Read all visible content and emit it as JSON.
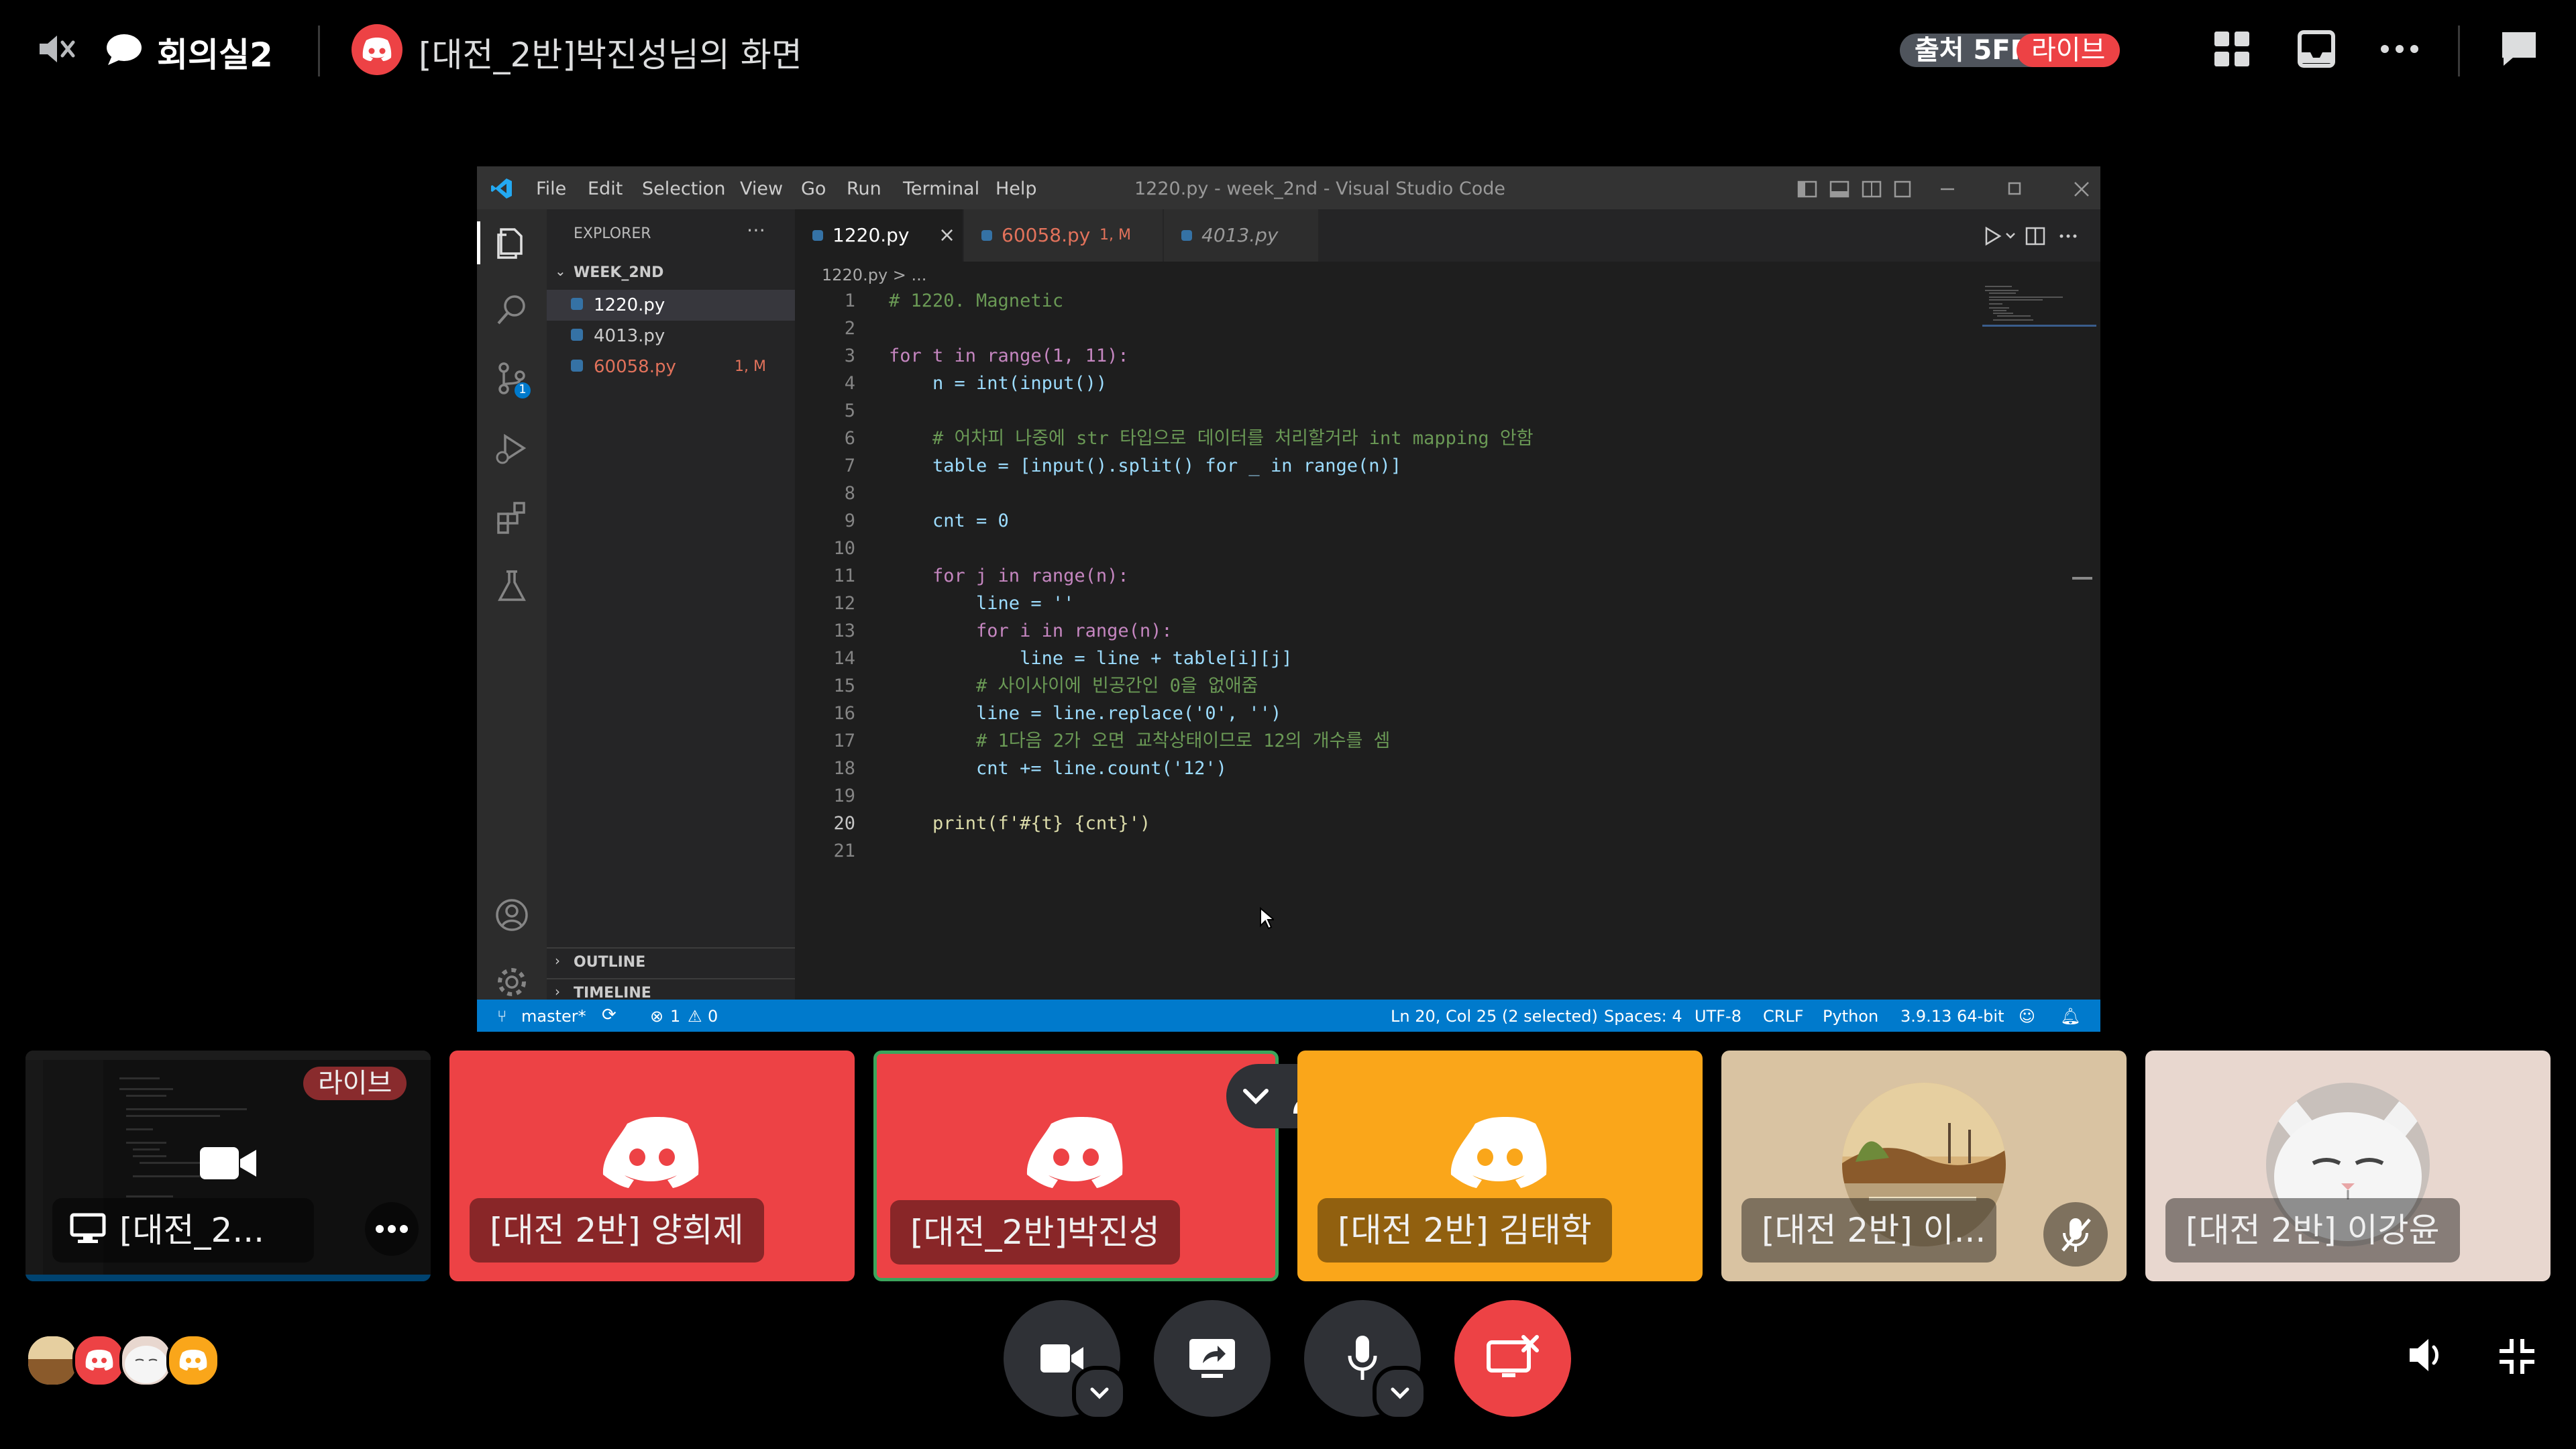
{
  "header": {
    "channel_name": "회의실2",
    "stream_title": "[대전_2반]박진성님의 화면",
    "quality_badge": "출처 5FPS",
    "live_badge": "라이브"
  },
  "vscode": {
    "window_title": "1220.py - week_2nd - Visual Studio Code",
    "menu": [
      "File",
      "Edit",
      "Selection",
      "View",
      "Go",
      "Run",
      "Terminal",
      "Help"
    ],
    "explorer_title": "EXPLORER",
    "folder": "WEEK_2ND",
    "files": [
      {
        "name": "1220.py",
        "badge": ""
      },
      {
        "name": "4013.py",
        "badge": ""
      },
      {
        "name": "60058.py",
        "badge": "1, M"
      }
    ],
    "outline_label": "OUTLINE",
    "timeline_label": "TIMELINE",
    "tabs": [
      {
        "name": "1220.py",
        "badge": ""
      },
      {
        "name": "60058.py",
        "badge": "1, M"
      },
      {
        "name": "4013.py",
        "badge": ""
      }
    ],
    "breadcrumb": "1220.py > ...",
    "source_control_count": "1",
    "line_numbers": [
      "1",
      "2",
      "3",
      "4",
      "5",
      "6",
      "7",
      "8",
      "9",
      "10",
      "11",
      "12",
      "13",
      "14",
      "15",
      "16",
      "17",
      "18",
      "19",
      "20",
      "21"
    ],
    "code_lines": [
      "# 1220. Magnetic",
      "",
      "for t in range(1, 11):",
      "    n = int(input())",
      "",
      "    # 어차피 나중에 str 타입으로 데이터를 처리할거라 int mapping 안함",
      "    table = [input().split() for _ in range(n)]",
      "",
      "    cnt = 0",
      "",
      "    for j in range(n):",
      "        line = ''",
      "        for i in range(n):",
      "            line = line + table[i][j]",
      "        # 사이사이에 빈공간인 0을 없애줌",
      "        line = line.replace('0', '')",
      "        # 1다음 2가 오면 교착상태이므로 12의 개수를 셈",
      "        cnt += line.count('12')",
      "",
      "    print(f'#{t} {cnt}')",
      ""
    ],
    "status": {
      "branch": "master*",
      "errors": "1",
      "warnings": "0",
      "position": "Ln 20, Col 25 (2 selected)",
      "spaces": "Spaces: 4",
      "encoding": "UTF-8",
      "eol": "CRLF",
      "language": "Python",
      "interpreter": "3.9.13 64-bit"
    }
  },
  "participants": [
    {
      "name": "[대전_2...",
      "type": "screen",
      "live": "라이브"
    },
    {
      "name": "[대전 2반] 양희제",
      "type": "discord",
      "color": "#ed4245"
    },
    {
      "name": "[대전_2반]박진성",
      "type": "discord",
      "color": "#ed4245"
    },
    {
      "name": "[대전 2반] 김태학",
      "type": "discord",
      "color": "#faa61a"
    },
    {
      "name": "[대전 2반] 이...",
      "type": "avatar-painting"
    },
    {
      "name": "[대전 2반] 이강윤",
      "type": "avatar-cat"
    }
  ],
  "colors": {
    "discord_red": "#ed4245",
    "discord_orange": "#faa61a",
    "live_red": "#ed4245",
    "speaking_green": "#3ba55c",
    "vscode_blue": "#007acc"
  },
  "icons": [
    "speaker-muted-icon",
    "chat-bubble-icon",
    "grid-icon",
    "inbox-icon",
    "more-icon",
    "chat-icon",
    "camera-icon",
    "screen-share-icon",
    "microphone-icon",
    "leave-icon",
    "volume-icon",
    "minimize-icon"
  ]
}
